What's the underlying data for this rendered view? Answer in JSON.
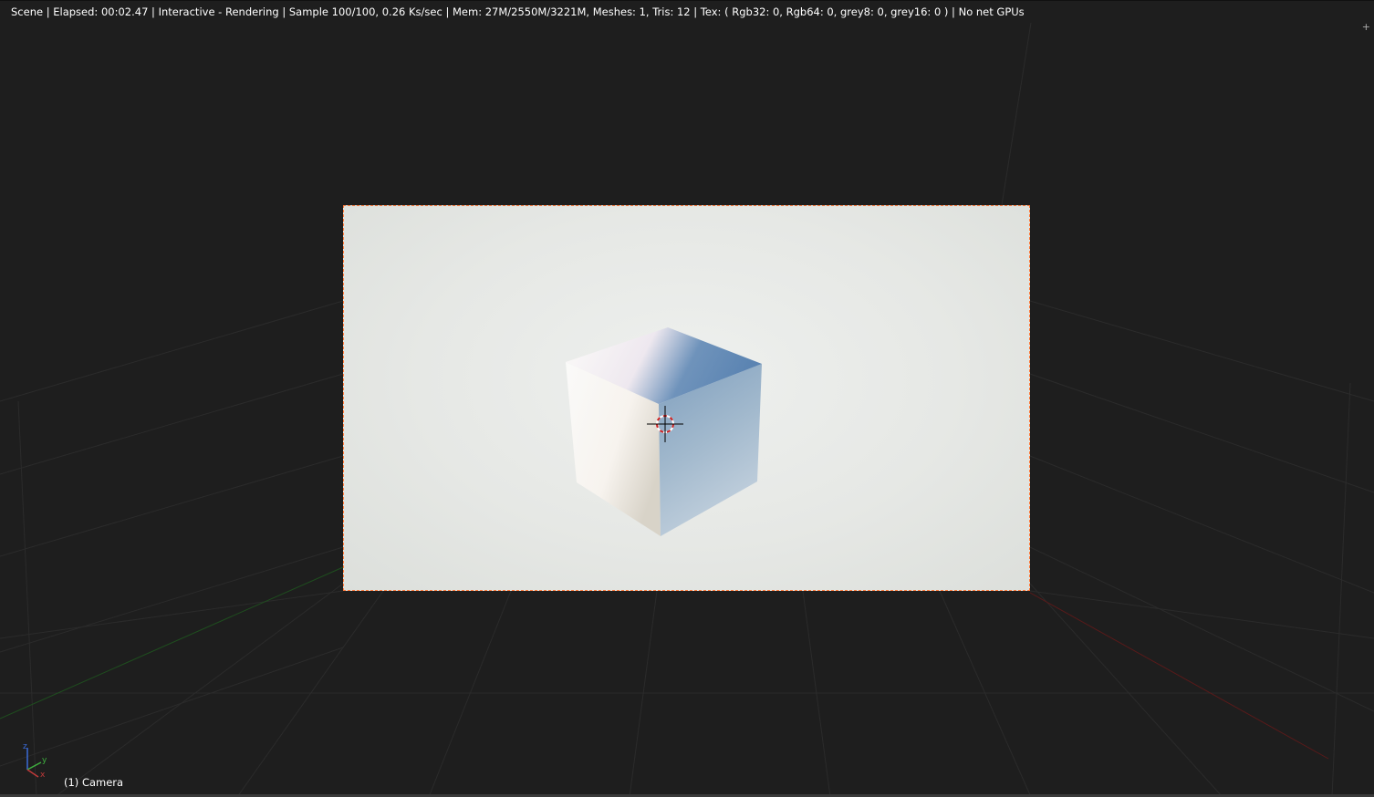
{
  "header": {
    "status": "Scene | Elapsed: 00:02.47 | Interactive - Rendering | Sample 100/100, 0.26 Ks/sec | Mem: 27M/2550M/3221M, Meshes: 1, Tris: 12 | Tex: ( Rgb32: 0, Rgb64: 0, grey8: 0, grey16: 0 ) | No net GPUs",
    "corner_icon": "+"
  },
  "footer": {
    "object_label": "(1) Camera"
  },
  "axes": {
    "x": "x",
    "y": "y",
    "z": "z"
  },
  "icons": {
    "cursor": "3d-cursor-icon",
    "axis": "axis-gizmo-icon",
    "corner": "area-split-icon"
  },
  "colors": {
    "background": "#1e1e1e",
    "grid": "#2c2c2c",
    "x_axis": "#6b1f1f",
    "y_axis": "#1f5a1f",
    "camera_border": "#ff7a3a"
  }
}
